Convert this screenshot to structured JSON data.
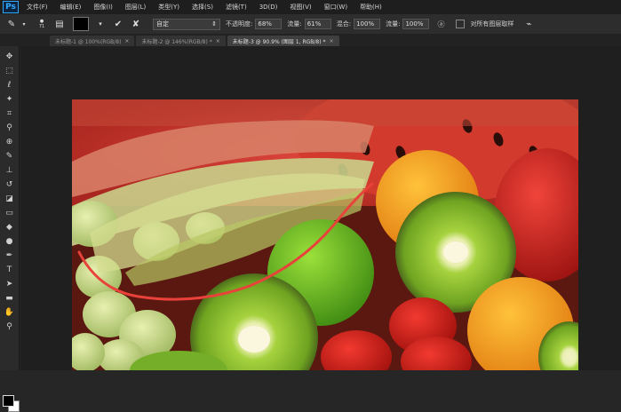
{
  "app": {
    "logo": "Ps"
  },
  "menu": [
    "文件(F)",
    "编辑(E)",
    "图像(I)",
    "图层(L)",
    "类型(Y)",
    "选择(S)",
    "滤镜(T)",
    "3D(D)",
    "视图(V)",
    "窗口(W)",
    "帮助(H)"
  ],
  "options": {
    "brush_size": "71",
    "mode_label": "自定",
    "opacity_label": "不透明度:",
    "opacity": "68%",
    "flow_label": "流量:",
    "flow": "61%",
    "mix_label": "混合:",
    "mix": "100%",
    "flow2_label": "流量:",
    "flow2": "100%",
    "all_layers_label": "对所有图层取样"
  },
  "tabs": [
    {
      "label": "未标题-1 @ 100%(RGB/8)",
      "close": "×"
    },
    {
      "label": "未标题-2 @ 146%(RGB/8) *",
      "close": "×"
    },
    {
      "label": "未标题-3 @ 90.9% (图层 1, RGB/8) *",
      "close": "×"
    }
  ],
  "colors": {
    "brush_stroke": "#e8423a",
    "accent": "#31a8ff"
  }
}
